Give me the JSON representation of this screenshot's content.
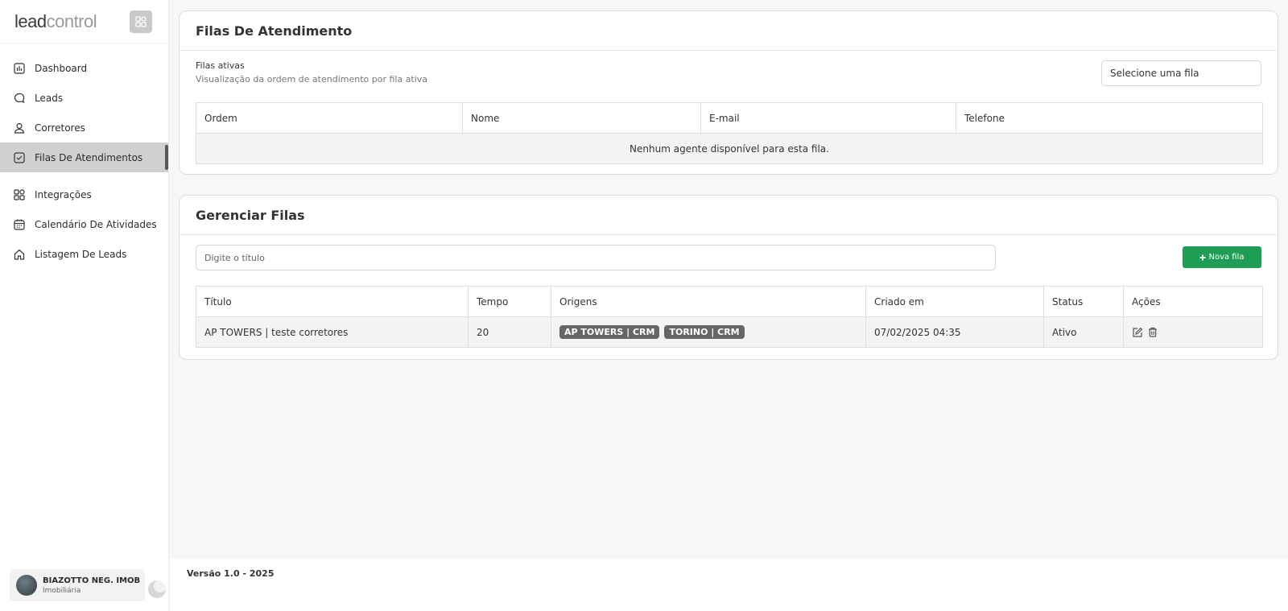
{
  "brand": {
    "logo_bold": "lead",
    "logo_light": "control"
  },
  "sidebar": {
    "items": [
      {
        "label": "Dashboard",
        "icon": "chart-icon"
      },
      {
        "label": "Leads",
        "icon": "chat-bubble-icon"
      },
      {
        "label": "Corretores",
        "icon": "user-icon"
      },
      {
        "label": "Filas De Atendimentos",
        "icon": "checkbox-icon",
        "active": true
      },
      {
        "label": "Integrações",
        "icon": "apps-grid-icon"
      },
      {
        "label": "Calendário De Atividades",
        "icon": "calendar-icon"
      },
      {
        "label": "Listagem De Leads",
        "icon": "home-icon"
      }
    ],
    "user": {
      "name": "BIAZOTTO NEG. IMOB",
      "role": "Imobiliária"
    }
  },
  "queues_card": {
    "title": "Filas De Atendimento",
    "subtitle": "Filas ativas",
    "description": "Visualização da ordem de atendimento por fila ativa",
    "select_value": "Selecione uma fila",
    "columns": [
      "Ordem",
      "Nome",
      "E-mail",
      "Telefone"
    ],
    "empty_message": "Nenhum agente disponível para esta fila."
  },
  "manage_card": {
    "title": "Gerenciar Filas",
    "search_placeholder": "Digite o título",
    "new_button": "Nova fila",
    "columns": [
      "Título",
      "Tempo",
      "Origens",
      "Criado em",
      "Status",
      "Ações"
    ],
    "rows": [
      {
        "titulo": "AP TOWERS | teste corretores",
        "tempo": "20",
        "origens": [
          "AP TOWERS | CRM",
          "TORINO | CRM"
        ],
        "criado_em": "07/02/2025 04:35",
        "status": "Ativo"
      }
    ]
  },
  "footer": {
    "version": "Versão 1.0 - 2025"
  },
  "colors": {
    "accent_green": "#1f9d55",
    "active_nav": "#cfd0d2",
    "badge": "#666666"
  }
}
